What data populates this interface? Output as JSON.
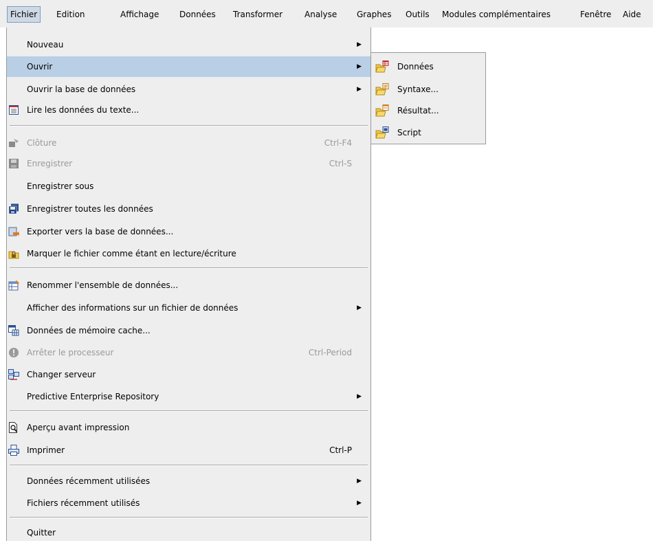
{
  "menubar": {
    "items": [
      {
        "label": "Fichier",
        "active": true
      },
      {
        "label": "Edition"
      },
      {
        "label": "Affichage"
      },
      {
        "label": "Données"
      },
      {
        "label": "Transformer"
      },
      {
        "label": "Analyse"
      },
      {
        "label": "Graphes"
      },
      {
        "label": "Outils"
      },
      {
        "label": "Modules complémentaires"
      },
      {
        "label": "Fenêtre"
      },
      {
        "label": "Aide"
      }
    ]
  },
  "file_menu": {
    "items": [
      {
        "label": "Nouveau",
        "submenu": true
      },
      {
        "label": "Ouvrir",
        "submenu": true,
        "highlighted": true
      },
      {
        "label": "Ouvrir la base de données",
        "submenu": true
      },
      {
        "label": "Lire les données du texte...",
        "icon": "text-data-icon"
      },
      {
        "label": "Clôture",
        "shortcut": "Ctrl-F4",
        "disabled": true,
        "icon": "close-window-icon"
      },
      {
        "label": "Enregistrer",
        "shortcut": "Ctrl-S",
        "disabled": true,
        "icon": "save-icon"
      },
      {
        "label": "Enregistrer sous"
      },
      {
        "label": "Enregistrer toutes les données",
        "icon": "save-all-icon"
      },
      {
        "label": "Exporter vers la base de données...",
        "icon": "export-database-icon"
      },
      {
        "label": "Marquer le fichier comme étant en lecture/écriture",
        "icon": "lock-file-icon"
      },
      {
        "label": "Renommer l'ensemble de données...",
        "icon": "rename-dataset-icon"
      },
      {
        "label": "Afficher des informations sur un fichier de données",
        "submenu": true
      },
      {
        "label": "Données de mémoire cache...",
        "icon": "cache-data-icon"
      },
      {
        "label": "Arrêter le processeur",
        "shortcut": "Ctrl-Period",
        "disabled": true,
        "icon": "stop-processor-icon"
      },
      {
        "label": "Changer serveur",
        "icon": "server-icon"
      },
      {
        "label": "Predictive Enterprise Repository",
        "submenu": true
      },
      {
        "label": "Aperçu avant impression",
        "icon": "print-preview-icon"
      },
      {
        "label": "Imprimer",
        "shortcut": "Ctrl-P",
        "icon": "print-icon"
      },
      {
        "label": "Données récemment utilisées",
        "submenu": true
      },
      {
        "label": "Fichiers récemment utilisés",
        "submenu": true
      },
      {
        "label": "Quitter"
      }
    ]
  },
  "open_submenu": {
    "items": [
      {
        "label": "Données",
        "icon": "open-data-icon"
      },
      {
        "label": "Syntaxe...",
        "icon": "open-syntax-icon"
      },
      {
        "label": "Résultat...",
        "icon": "open-output-icon"
      },
      {
        "label": "Script",
        "icon": "open-script-icon"
      }
    ]
  },
  "glyphs": {
    "submenu_arrow": "▶"
  },
  "colors": {
    "menu_bg": "#eeeeee",
    "highlight": "#b8cfe5",
    "disabled_text": "#9a9a9a"
  }
}
